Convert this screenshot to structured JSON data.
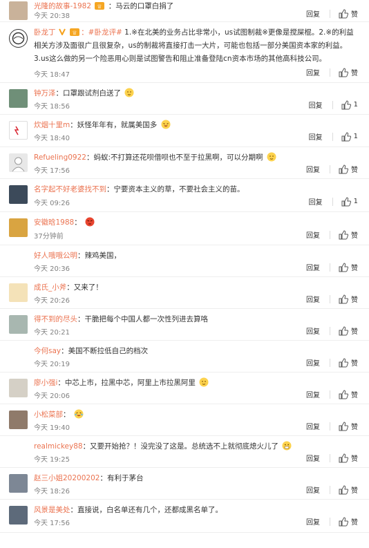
{
  "actions": {
    "reply": "回复",
    "like": "赞"
  },
  "comments": [
    {
      "user": "光隆的故事-1982",
      "text": "：马云的口罩白捐了",
      "time": "今天 20:38",
      "likes": "赞",
      "badge": true
    },
    {
      "user": "卧龙丁",
      "tag": "：#卧龙评#",
      "text": " 1.※在北美的业务占比非常小，us试图制裁※更像是搅屎棍。2.※的利益相关方涉及面很广且很复杂，us的制裁将直接打击一大片，可能也包括一部分美国资本家的利益。3.us这么做的另一个险恶用心则是试图警告和阻止准备登陆cn资本市场的其他高科技公司。",
      "time": "今天 18:47",
      "likes": "赞",
      "badge": true
    },
    {
      "user": "钟万泽",
      "text": "：口罩跟试剂白送了",
      "time": "今天 18:56",
      "likes": "1",
      "emoji": "smirk"
    },
    {
      "user": "炊烟十里m",
      "text": "：妖怪年年有，就属美国多",
      "time": "今天 18:40",
      "likes": "1",
      "emoji": "laugh"
    },
    {
      "user": "Refueling0922",
      "text": "：蚂蚁:不打算还花呗借呗也不至于拉黑啊，可以分期啊",
      "time": "今天 17:56",
      "likes": "赞",
      "emoji": "smirk"
    },
    {
      "user": "名字起不好老婆找不到",
      "text": "：宁要资本主义的草，不要社会主义的苗。",
      "time": "今天 09:26",
      "likes": "1"
    },
    {
      "user": "安徽晗1988",
      "text": "：",
      "time": "37分钟前",
      "likes": "赞",
      "emoji": "angry"
    },
    {
      "user": "好人哦哦公明",
      "text": "：辣鸡美国，",
      "time": "今天 20:36",
      "likes": "赞"
    },
    {
      "user": "成氏_小斧",
      "text": "：又来了！",
      "time": "今天 20:26",
      "likes": "赞"
    },
    {
      "user": "得不到的尽头",
      "text": "：干脆把每个中国人都一次性列进去算咯",
      "time": "今天 20:21",
      "likes": "赞"
    },
    {
      "user": "今何say",
      "text": "：美国不断拉低自己的档次",
      "time": "今天 20:19",
      "likes": "赞"
    },
    {
      "user": "廖小强i",
      "text": "：中芯上市，拉黑中芯，阿里上市拉黑阿里",
      "time": "今天 20:06",
      "likes": "赞",
      "emoji": "smirk"
    },
    {
      "user": "小松菜部",
      "text": "：",
      "time": "今天 19:40",
      "likes": "赞",
      "emoji": "cry"
    },
    {
      "user": "realmickey88",
      "text": "：又要开始抢？！没完没了这是。总统选不上就彻底熄火儿了",
      "time": "今天 19:25",
      "likes": "赞",
      "emoji": "grin"
    },
    {
      "user": "赵三小姐20200202",
      "text": "：有利于茅台",
      "time": "今天 18:26",
      "likes": "赞"
    },
    {
      "user": "风景是美处",
      "text": "：直接说，白名单还有几个，还都成黑名单了。",
      "time": "今天 17:56",
      "likes": "赞"
    }
  ]
}
